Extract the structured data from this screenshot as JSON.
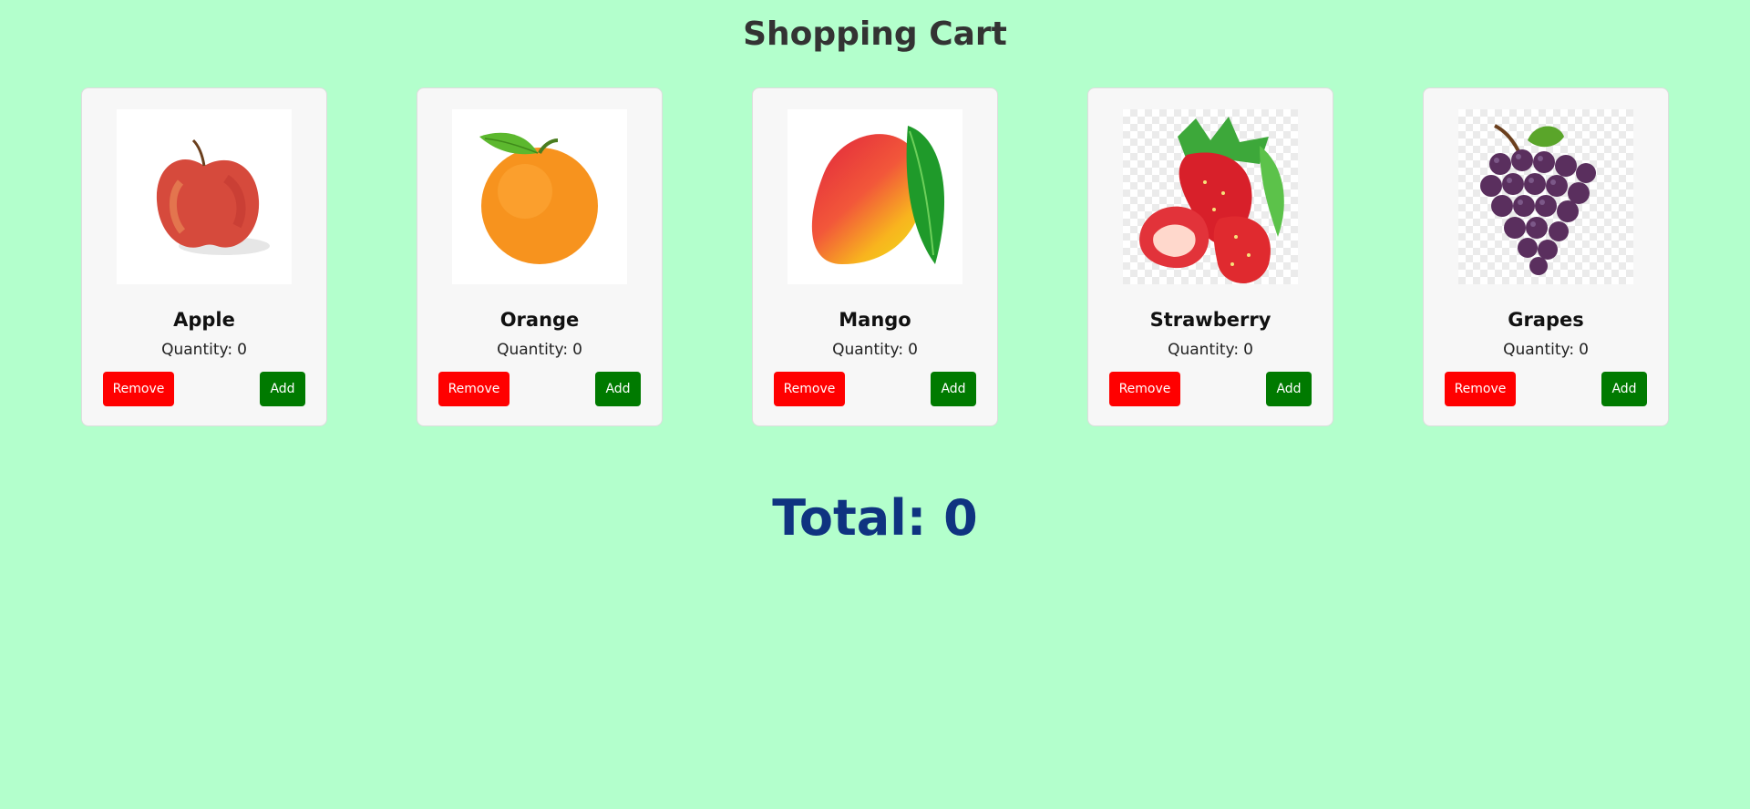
{
  "header": {
    "title": "Shopping Cart"
  },
  "quantity_label": "Quantity:",
  "products": [
    {
      "name": "Apple",
      "quantity": "0",
      "remove_label": "Remove",
      "add_label": "Add",
      "icon": "apple-image"
    },
    {
      "name": "Orange",
      "quantity": "0",
      "remove_label": "Remove",
      "add_label": "Add",
      "icon": "orange-image"
    },
    {
      "name": "Mango",
      "quantity": "0",
      "remove_label": "Remove",
      "add_label": "Add",
      "icon": "mango-image"
    },
    {
      "name": "Strawberry",
      "quantity": "0",
      "remove_label": "Remove",
      "add_label": "Add",
      "icon": "strawberry-image"
    },
    {
      "name": "Grapes",
      "quantity": "0",
      "remove_label": "Remove",
      "add_label": "Add",
      "icon": "grapes-image"
    }
  ],
  "total": {
    "label": "Total:",
    "value": "0"
  },
  "colors": {
    "background": "#b3ffcc",
    "remove_button": "#ff0000",
    "add_button": "#007a00",
    "total_text": "#0f3380"
  }
}
